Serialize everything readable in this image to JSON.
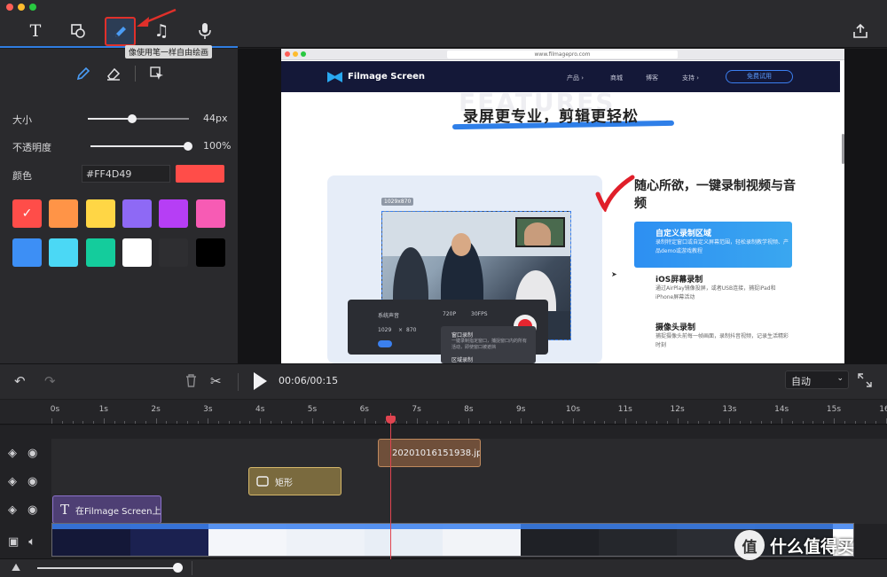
{
  "toolbar": {
    "tools": [
      {
        "icon": "text-icon"
      },
      {
        "icon": "shape-icon"
      },
      {
        "icon": "pen-icon",
        "active": true
      },
      {
        "icon": "music-icon"
      },
      {
        "icon": "microphone-icon"
      }
    ],
    "tooltip": "像使用笔一样自由绘画",
    "export_icon": "export-icon",
    "accent_color": "#2f7de1",
    "highlight_color": "#e0302a"
  },
  "pen_panel": {
    "size_label": "大小",
    "size_value": "44px",
    "size_fraction": 0.44,
    "opacity_label": "不透明度",
    "opacity_value": "100%",
    "opacity_fraction": 1.0,
    "color_label": "颜色",
    "color_hex": "#FF4D49",
    "current_color": "#FF4D49",
    "swatches": [
      "#FF4D49",
      "#FF9447",
      "#FFD645",
      "#8E69F5",
      "#B63EF5",
      "#F75BB4",
      "#3D8FF5",
      "#4BD8F5",
      "#14CC9C",
      "#FFFFFF",
      "#2E2E31",
      "#000000"
    ],
    "selected_swatch": 0
  },
  "preview": {
    "url": "www.filmagepro.com",
    "brand": "Filmage Screen",
    "menu": [
      "产品 ›",
      "商城",
      "博客",
      "支持 ›"
    ],
    "trial_button": "免费试用",
    "ghost_text": "FEATURES",
    "headline": "录屏更专业，剪辑更轻松",
    "size_tag": "1029x870",
    "feature_title": "随心所欲，一键录制视频与音频",
    "features": [
      {
        "title": "自定义录制区域",
        "desc": "录制特定窗口或自定义屏幕范围，轻松录制教学视频、产品demo或游戏教程"
      },
      {
        "title": "iOS屏幕录制",
        "desc": "通过AirPlay镜像投屏，或者USB连接，捕捉iPad和iPhone屏幕活动"
      },
      {
        "title": "摄像头录制",
        "desc": "捕捉摄像头前每一帧画面，录制抖音视频，记录生活精彩时刻"
      }
    ],
    "panel": {
      "audio": "系统声音",
      "resolution": "720P",
      "fps": "30FPS",
      "width": "1029",
      "x": "×",
      "height": "870",
      "menu_items": [
        "窗口录制",
        "一键录制指定窗口，捕捉窗口内的所有活动，即使窗口被遮挡",
        "区域录制"
      ]
    }
  },
  "controls": {
    "timecode": "00:06/00:15",
    "zoom_mode": "自动",
    "icons": [
      "undo-icon",
      "redo-icon",
      "trash-icon",
      "scissors-icon",
      "play-icon",
      "fullscreen-icon"
    ]
  },
  "timeline": {
    "ticks": [
      "0s",
      "1s",
      "2s",
      "3s",
      "4s",
      "5s",
      "6s",
      "7s",
      "8s",
      "9s",
      "10s",
      "11s",
      "12s",
      "13s",
      "14s",
      "15s",
      "16"
    ],
    "playhead_time": 6.5,
    "clips": [
      {
        "label": "20201016151938.jp",
        "icon": "pen-icon",
        "color": "#6f4f3a",
        "border": "#c08a5e"
      },
      {
        "label": "矩形",
        "icon": "rectangle-icon",
        "color": "#7a6a3e",
        "border": "#d6b86a"
      },
      {
        "label": "在Filmage Screen上剪",
        "icon": "text-icon",
        "color": "#4e3f74",
        "border": "#8c72cc"
      }
    ]
  },
  "watermark": {
    "badge": "值",
    "text": "什么值得买"
  }
}
